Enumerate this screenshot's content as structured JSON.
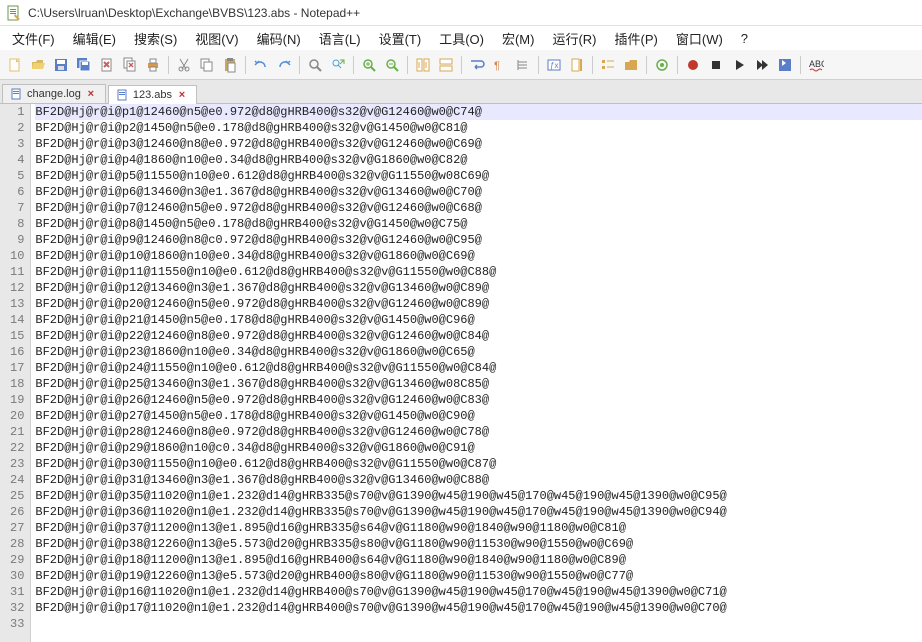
{
  "window": {
    "title": "C:\\Users\\lruan\\Desktop\\Exchange\\BVBS\\123.abs - Notepad++"
  },
  "menu": {
    "items": [
      "文件(F)",
      "编辑(E)",
      "搜索(S)",
      "视图(V)",
      "编码(N)",
      "语言(L)",
      "设置(T)",
      "工具(O)",
      "宏(M)",
      "运行(R)",
      "插件(P)",
      "窗口(W)",
      "?"
    ]
  },
  "tabs": [
    {
      "label": "change.log",
      "active": false
    },
    {
      "label": "123.abs",
      "active": true
    }
  ],
  "editor": {
    "current_line": 1,
    "lines": [
      "BF2D@Hj@r@i@p1@12460@n5@e0.972@d8@gHRB400@s32@v@G12460@w0@C74@",
      "BF2D@Hj@r@i@p2@1450@n5@e0.178@d8@gHRB400@s32@v@G1450@w0@C81@",
      "BF2D@Hj@r@i@p3@12460@n8@e0.972@d8@gHRB400@s32@v@G12460@w0@C69@",
      "BF2D@Hj@r@i@p4@1860@n10@e0.34@d8@gHRB400@s32@v@G1860@w0@C82@",
      "BF2D@Hj@r@i@p5@11550@n10@e0.612@d8@gHRB400@s32@v@G11550@w08C69@",
      "BF2D@Hj@r@i@p6@13460@n3@e1.367@d8@gHRB400@s32@v@G13460@w0@C70@",
      "BF2D@Hj@r@i@p7@12460@n5@e0.972@d8@gHRB400@s32@v@G12460@w0@C68@",
      "BF2D@Hj@r@i@p8@1450@n5@e0.178@d8@gHRB400@s32@v@G1450@w0@C75@",
      "BF2D@Hj@r@i@p9@12460@n8@c0.972@d8@gHRB400@s32@v@G12460@w0@C95@",
      "BF2D@Hj@r@i@p10@1860@n10@e0.34@d8@gHRB400@s32@v@G1860@w0@C69@",
      "BF2D@Hj@r@i@p11@11550@n10@e0.612@d8@gHRB400@s32@v@G11550@w0@C88@",
      "BF2D@Hj@r@i@p12@13460@n3@e1.367@d8@gHRB400@s32@v@G13460@w0@C89@",
      "BF2D@Hj@r@i@p20@12460@n5@e0.972@d8@gHRB400@s32@v@G12460@w0@C89@",
      "BF2D@Hj@r@i@p21@1450@n5@e0.178@d8@gHRB400@s32@v@G1450@w0@C96@",
      "BF2D@Hj@r@i@p22@12460@n8@e0.972@d8@gHRB400@s32@v@G12460@w0@C84@",
      "BF2D@Hj@r@i@p23@1860@n10@e0.34@d8@gHRB400@s32@v@G1860@w0@C65@",
      "BF2D@Hj@r@i@p24@11550@n10@e0.612@d8@gHRB400@s32@v@G11550@w0@C84@",
      "BF2D@Hj@r@i@p25@13460@n3@e1.367@d8@gHRB400@s32@v@G13460@w08C85@",
      "BF2D@Hj@r@i@p26@12460@n5@e0.972@d8@gHRB400@s32@v@G12460@w0@C83@",
      "BF2D@Hj@r@i@p27@1450@n5@e0.178@d8@gHRB400@s32@v@G1450@w0@C90@",
      "BF2D@Hj@r@i@p28@12460@n8@e0.972@d8@gHRB400@s32@v@G12460@w0@C78@",
      "BF2D@Hj@r@i@p29@1860@n10@c0.34@d8@gHRB400@s32@v@G1860@w0@C91@",
      "BF2D@Hj@r@i@p30@11550@n10@e0.612@d8@gHRB400@s32@v@G11550@w0@C87@",
      "BF2D@Hj@r@i@p31@13460@n3@e1.367@d8@gHRB400@s32@v@G13460@w0@C88@",
      "BF2D@Hj@r@i@p35@11020@n1@e1.232@d14@gHRB335@s70@v@G1390@w45@190@w45@170@w45@190@w45@1390@w0@C95@",
      "BF2D@Hj@r@i@p36@11020@n1@e1.232@d14@gHRB335@s70@v@G1390@w45@190@w45@170@w45@190@w45@1390@w0@C94@",
      "BF2D@Hj@r@i@p37@11200@n13@e1.895@d16@gHRB335@s64@v@G1180@w90@1840@w90@1180@w0@C81@",
      "BF2D@Hj@r@i@p38@12260@n13@e5.573@d20@gHRB335@s80@v@G1180@w90@11530@w90@1550@w0@C69@",
      "BF2D@Hj@r@i@p18@11200@n13@e1.895@d16@gHRB400@s64@v@G1180@w90@1840@w90@1180@w0@C89@",
      "BF2D@Hj@r@i@p19@12260@n13@e5.573@d20@gHRB400@s80@v@G1180@w90@11530@w90@1550@w0@C77@",
      "BF2D@Hj@r@i@p16@11020@n1@e1.232@d14@gHRB400@s70@v@G1390@w45@190@w45@170@w45@190@w45@1390@w0@C71@",
      "BF2D@Hj@r@i@p17@11020@n1@e1.232@d14@gHRB400@s70@v@G1390@w45@190@w45@170@w45@190@w45@1390@w0@C70@",
      ""
    ]
  },
  "toolbar_icons": [
    "new",
    "open",
    "save",
    "save-all",
    "close",
    "close-all",
    "print",
    "sep",
    "cut",
    "copy",
    "paste",
    "sep",
    "undo",
    "redo",
    "sep",
    "find",
    "replace",
    "sep",
    "zoom-in",
    "zoom-out",
    "sep",
    "sync-v",
    "sync-h",
    "sep",
    "wrap",
    "all-chars",
    "indent-guide",
    "sep",
    "lang",
    "doc-map",
    "sep",
    "func-list",
    "folder",
    "sep",
    "monitor",
    "sep",
    "record",
    "stop",
    "play",
    "play-multi",
    "save-macro",
    "sep",
    "spellcheck"
  ],
  "icon_colors": {
    "new": "#e0c068",
    "open": "#d8b860",
    "save": "#5a7ec8",
    "save-all": "#5a7ec8",
    "close": "#c86060",
    "close-all": "#c86060",
    "print": "#d89850",
    "cut": "#888",
    "copy": "#888",
    "paste": "#888",
    "undo": "#5a8ed8",
    "redo": "#5a8ed8",
    "find": "#888",
    "replace": "#4aa0e0",
    "zoom-in": "#6ab04c",
    "zoom-out": "#6ab04c",
    "sync-v": "#d8a850",
    "sync-h": "#d8a850",
    "wrap": "#5a7ec8",
    "all-chars": "#d88850",
    "indent-guide": "#888",
    "lang": "#5a7ec8",
    "doc-map": "#d8a850",
    "func-list": "#d8a850",
    "folder": "#d8a850",
    "monitor": "#6ab04c",
    "record": "#c0392b",
    "stop": "#333",
    "play": "#333",
    "play-multi": "#333",
    "save-macro": "#5a7ec8",
    "spellcheck": "#c0392b"
  }
}
